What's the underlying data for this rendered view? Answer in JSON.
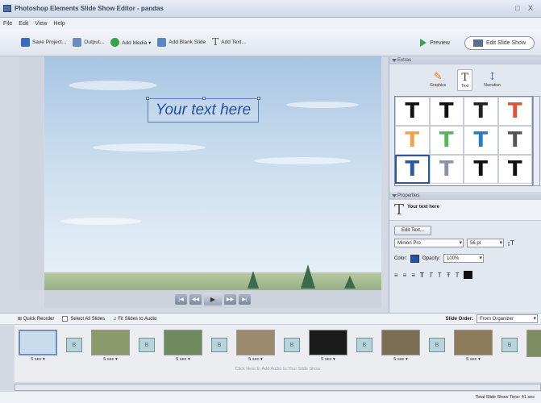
{
  "window": {
    "title": "Photoshop Elements Slide Show Editor - pandas",
    "controls": "□ X"
  },
  "menu": [
    "File",
    "Edit",
    "View",
    "Help"
  ],
  "toolbar": {
    "save": "Save Project...",
    "output": "Output...",
    "add_media": "Add Media ▾",
    "add_blank": "Add Blank Slide",
    "add_text": "Add Text...",
    "preview": "Preview",
    "edit_slideshow": "Edit Slide Show"
  },
  "stage": {
    "text": "Your text here"
  },
  "transport": {
    "first": "|◀",
    "prev": "◀◀",
    "play": "▶",
    "next": "▶▶",
    "last": "▶|"
  },
  "extras": {
    "header": "Extras",
    "tabs": [
      {
        "glyph": "✎",
        "label": "Graphics"
      },
      {
        "glyph": "T",
        "label": "Text"
      },
      {
        "glyph": "↕",
        "label": "Narration"
      }
    ],
    "styles": [
      {
        "c": "#111111"
      },
      {
        "c": "#111111"
      },
      {
        "c": "#222222"
      },
      {
        "c": "#d9573b"
      },
      {
        "c": "#f2a24a"
      },
      {
        "c": "#57b55a"
      },
      {
        "c": "#2d7bbd"
      },
      {
        "c": "#555555"
      },
      {
        "c": "#2b58a6"
      },
      {
        "c": "#8a93a3"
      },
      {
        "c": "#111111"
      },
      {
        "c": "#111111"
      }
    ]
  },
  "properties": {
    "header": "Properties",
    "name": "Your text here",
    "edit_text": "Edit Text...",
    "font": "Minion Pro",
    "size": "56 pt",
    "color_label": "Color:",
    "opacity_label": "Opacity:",
    "opacity": "100%",
    "color": "#2050b0"
  },
  "filmbar": {
    "quick_reorder": "Quick Reorder",
    "select_all": "Select All Slides",
    "fit_audio": "Fit Slides to Audio",
    "slide_order_label": "Slide Order:",
    "slide_order": "From Organizer"
  },
  "slides": [
    {
      "dur": "5 sec ▾",
      "color": "#c9dcee"
    },
    {
      "dur": "5 sec ▾",
      "color": "#8c9a6b"
    },
    {
      "dur": "5 sec ▾",
      "color": "#6f8a5e"
    },
    {
      "dur": "5 sec ▾",
      "color": "#9b8a6e"
    },
    {
      "dur": "5 sec ▾",
      "color": "#1a1a1a"
    },
    {
      "dur": "5 sec ▾",
      "color": "#7b6e55"
    },
    {
      "dur": "5 sec ▾",
      "color": "#8c7a5a"
    },
    {
      "dur": "",
      "color": "#7e8c63"
    }
  ],
  "audio_hint": "Click Here to Add Audio to Your Slide Show",
  "status": "Total Slide Show Time: 41 sec"
}
